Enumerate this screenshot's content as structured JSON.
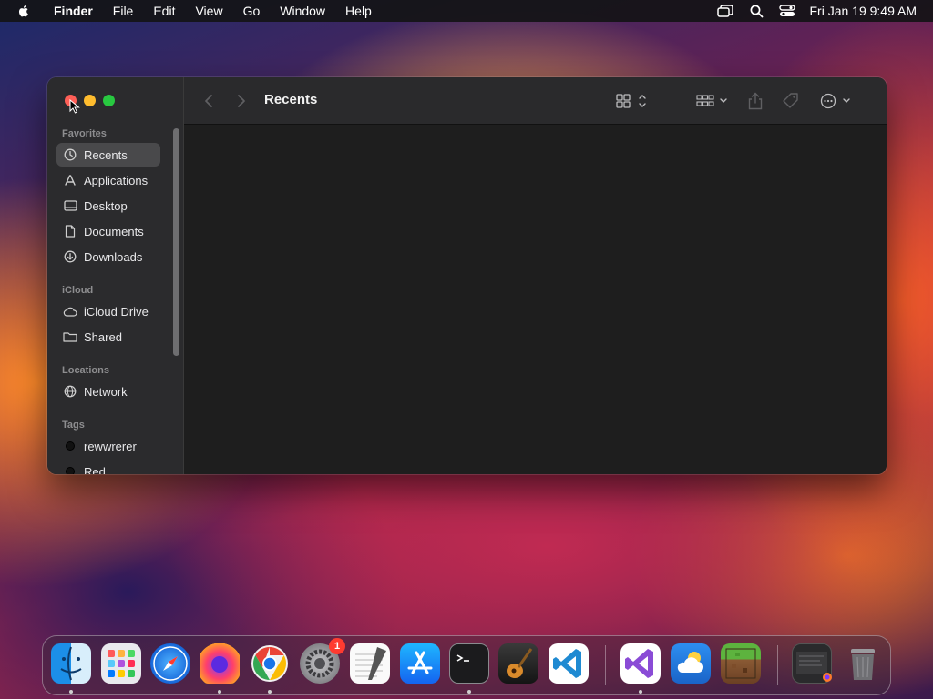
{
  "menubar": {
    "app": "Finder",
    "items": [
      "File",
      "Edit",
      "View",
      "Go",
      "Window",
      "Help"
    ],
    "clock": "Fri Jan 19  9:49 AM"
  },
  "window": {
    "title": "Recents",
    "sidebar": {
      "sections": {
        "favorites": "Favorites",
        "icloud": "iCloud",
        "locations": "Locations",
        "tags": "Tags"
      },
      "favorites": [
        "Recents",
        "Applications",
        "Desktop",
        "Documents",
        "Downloads"
      ],
      "icloud": [
        "iCloud Drive",
        "Shared"
      ],
      "locations": [
        "Network"
      ],
      "tags": [
        "rewwrerer",
        "Red"
      ]
    }
  },
  "dock": {
    "apps": [
      "Finder",
      "Launchpad",
      "Safari",
      "Firefox",
      "Chrome",
      "System Settings",
      "TextEdit",
      "App Store",
      "Terminal",
      "GarageBand",
      "Visual Studio Code",
      "Visual Studio",
      "Weather",
      "Minecraft",
      "Downloads",
      "Trash"
    ],
    "settings_badge": "1"
  }
}
